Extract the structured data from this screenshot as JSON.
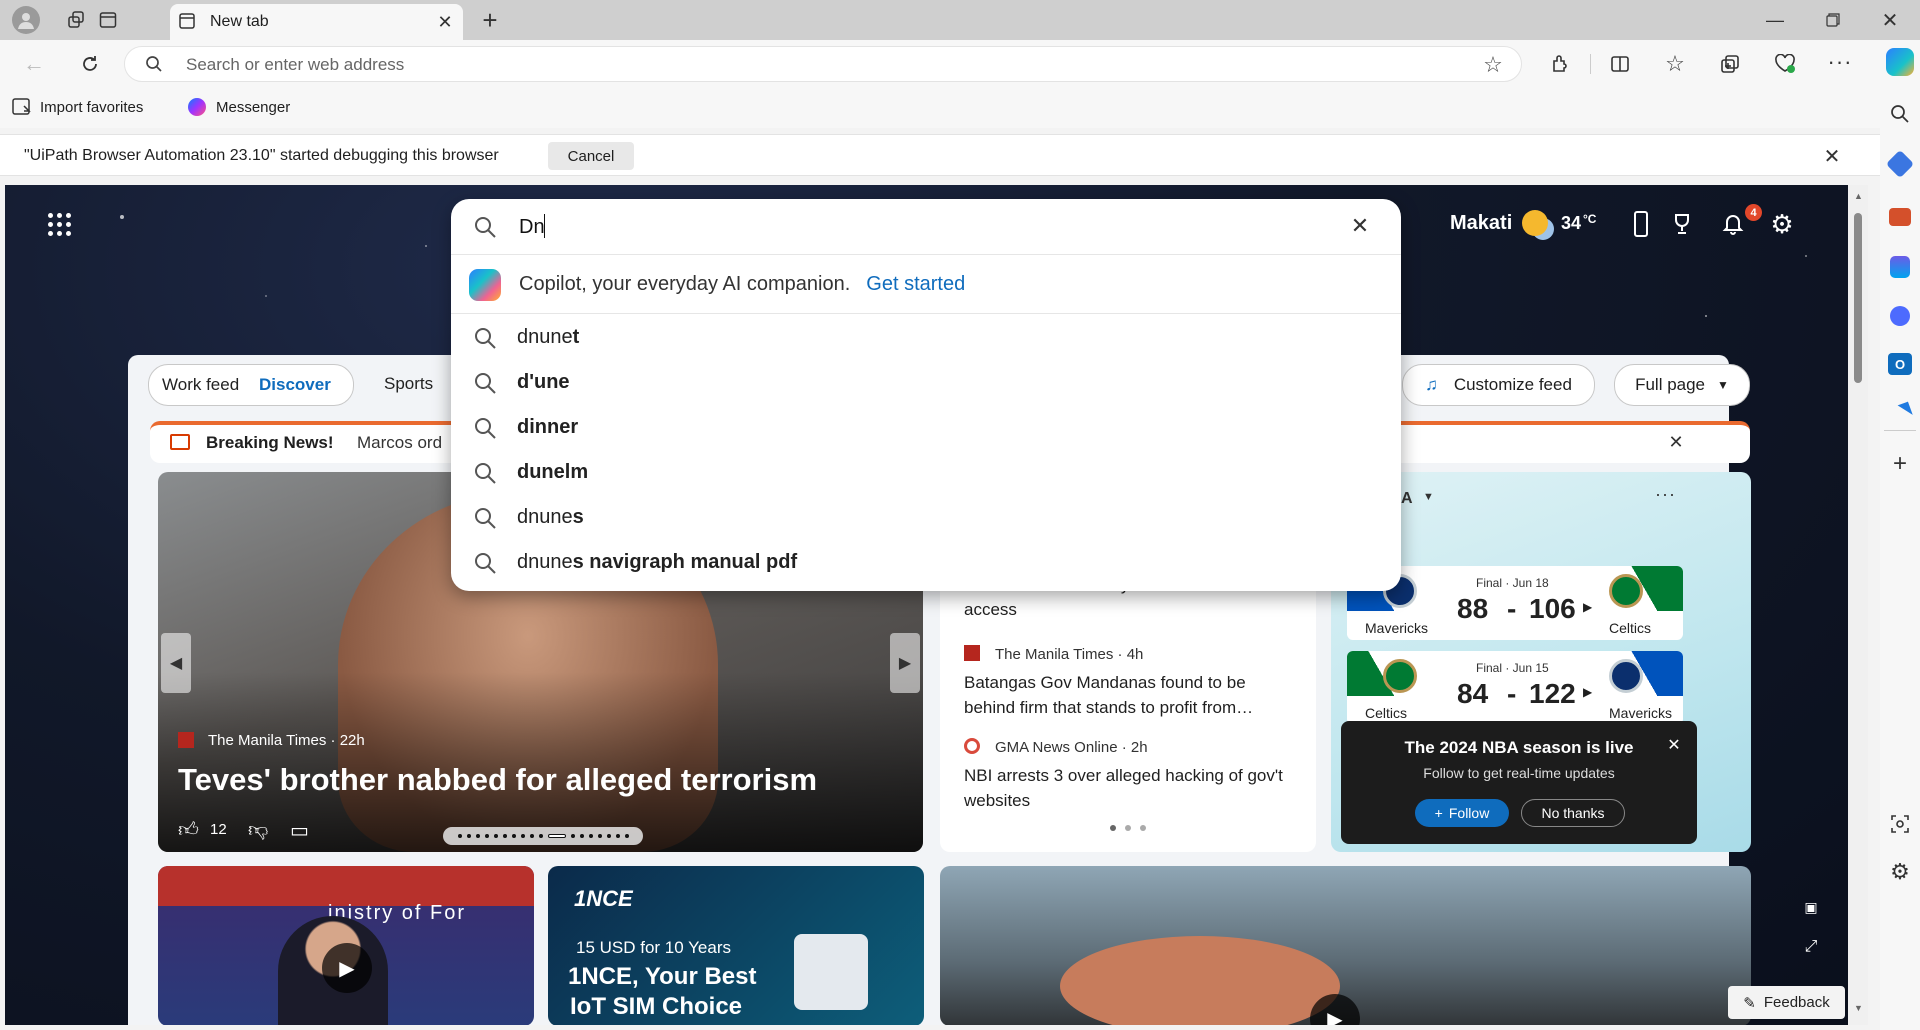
{
  "browser": {
    "tab_title": "New tab",
    "address_placeholder": "Search or enter web address",
    "favorites": [
      "Import favorites",
      "Messenger"
    ],
    "infobar_text": "\"UiPath Browser Automation 23.10\" started debugging this browser",
    "infobar_cancel": "Cancel"
  },
  "header": {
    "location": "Makati",
    "temperature": "34",
    "temp_unit": "°C",
    "notification_count": "4"
  },
  "search": {
    "query": "Dn",
    "copilot_text": "Copilot, your everyday AI companion.",
    "copilot_link": "Get started",
    "suggestions": [
      {
        "typed": "dnune",
        "rest": "t"
      },
      {
        "typed": "",
        "rest": "d'une"
      },
      {
        "typed": "",
        "rest": "dinner"
      },
      {
        "typed": "",
        "rest": "dunelm"
      },
      {
        "typed": "dnune",
        "rest": "s"
      },
      {
        "typed": "dnune",
        "rest": "s navigraph manual pdf"
      }
    ]
  },
  "feed": {
    "tabs": [
      "Work feed",
      "Discover",
      "Sports"
    ],
    "customize": "Customize feed",
    "full_page": "Full page",
    "breaking_label": "Breaking News!",
    "breaking_text": "Marcos ord"
  },
  "hero": {
    "source": "The Manila Times · 22h",
    "title": "Teves' brother nabbed for alleged terrorism",
    "likes": "12"
  },
  "news_list": [
    {
      "source": "",
      "title": "Marcos orders 30-day toll-free Cavitex access"
    },
    {
      "source": "The Manila Times · 4h",
      "title": "Batangas Gov Mandanas found to be behind firm that stands to profit from…"
    },
    {
      "source": "GMA News Online · 2h",
      "title": "NBI arrests 3 over alleged hacking of gov't websites"
    }
  ],
  "nba": {
    "header_fragment": "A",
    "games": [
      {
        "status": "Final · Jun 18",
        "score_left": "88",
        "score_right": "106",
        "team_left": "Mavericks",
        "team_right": "Celtics"
      },
      {
        "status": "Final · Jun 15",
        "score_left": "84",
        "score_right": "122",
        "team_left": "Celtics",
        "team_right": "Mavericks"
      }
    ],
    "popup_title": "The 2024 NBA season is live",
    "popup_sub": "Follow to get real-time updates",
    "follow": "Follow",
    "no_thanks": "No thanks"
  },
  "bottom_cards": {
    "ad_brand": "1NCE",
    "ad_price": "15 USD for 10 Years",
    "ad_title_line1": "1NCE, Your Best",
    "ad_title_line2": "IoT SIM Choice",
    "video_caption": "inistry of For",
    "feedback": "Feedback"
  },
  "colors": {
    "accent": "#0f6cbd",
    "follow": "#0f6cbd",
    "breaking": "#d83b01"
  }
}
